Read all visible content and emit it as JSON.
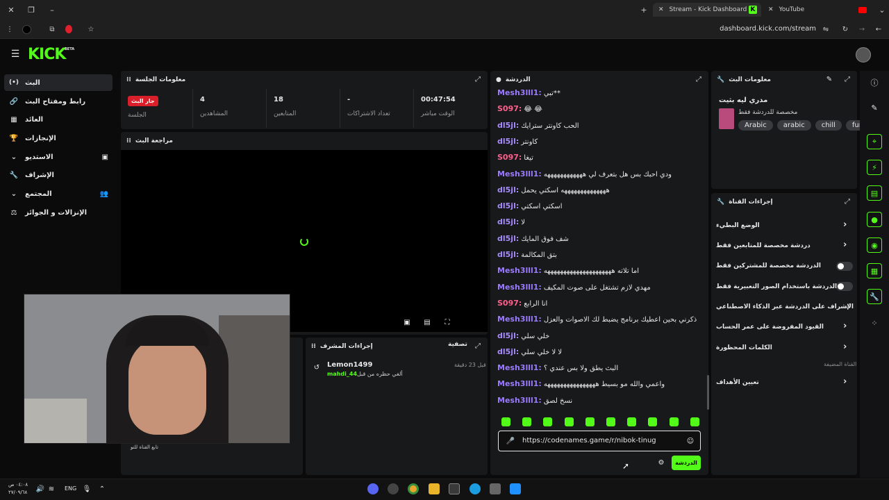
{
  "browser": {
    "tabs": [
      {
        "label": "Stream - Kick Dashboard"
      },
      {
        "label": "YouTube"
      }
    ],
    "url": "dashboard.kick.com/stream"
  },
  "kick": {
    "logo": "KICK",
    "beta": "BETA"
  },
  "sidebar": {
    "items": [
      {
        "label": "البث",
        "icon": "broadcast-icon"
      },
      {
        "label": "رابط ومفتاح البث",
        "icon": "link-icon"
      },
      {
        "label": "العائد",
        "icon": "revenue-icon"
      },
      {
        "label": "الإنجازات",
        "icon": "trophy-icon"
      },
      {
        "label": "الاستديو",
        "icon": "studio-icon"
      },
      {
        "label": "الإشراف",
        "icon": "wrench-icon"
      },
      {
        "label": "المجتمع",
        "icon": "community-icon"
      },
      {
        "label": "الإنزالات و الجوائز",
        "icon": "drops-icon"
      }
    ]
  },
  "session": {
    "title": "معلومات الجلسة",
    "live_badge": "جار البث",
    "live_label": "الجلسة",
    "stats": [
      {
        "value": "4",
        "label": "المشاهدين"
      },
      {
        "value": "18",
        "label": "المتابعين"
      },
      {
        "value": "-",
        "label": "تعداد الاشتراكات"
      },
      {
        "value": "00:47:54",
        "label": "الوقت مباشر"
      }
    ]
  },
  "preview": {
    "title": "مراجعة البث"
  },
  "mod_actions": {
    "title": "إجراءات المشرف",
    "filter": "تصفية",
    "entry_user": "Lemon1499",
    "entry_time": "قبل 23 دقيقة",
    "entry_text": "ألغي حظره من قبل",
    "entry_actor": "mahdi_44",
    "follow_text": "تابع القناة للتو"
  },
  "chat": {
    "title": "الدردشة",
    "messages": [
      {
        "user": "Mesh3lll1:",
        "text": "**تبي",
        "color": "#9b7bff"
      },
      {
        "user": "S097:",
        "text": "😂 😂",
        "color": "#ff5f8d"
      },
      {
        "user": "dl5jl:",
        "text": "الحب كاونتر سترايك",
        "color": "#a78bff"
      },
      {
        "user": "dl5jl:",
        "text": "كاونتر",
        "color": "#a78bff"
      },
      {
        "user": "S097:",
        "text": "تيغا",
        "color": "#ff5f8d"
      },
      {
        "user": "Mesh3lll1:",
        "text": "ودي احبك بس هل بتعرف لي ههههههههههههه",
        "color": "#9b7bff"
      },
      {
        "user": "dl5jl:",
        "text": "ههههههههههههههه اسكتي يحمل",
        "color": "#a78bff"
      },
      {
        "user": "dl5jl:",
        "text": "اسكتي اسكتي",
        "color": "#a78bff"
      },
      {
        "user": "dl5jl:",
        "text": "لا",
        "color": "#a78bff"
      },
      {
        "user": "dl5jl:",
        "text": "شف فوق المايك",
        "color": "#a78bff"
      },
      {
        "user": "dl5jl:",
        "text": "بتق المكالمة",
        "color": "#a78bff"
      },
      {
        "user": "Mesh3lll1:",
        "text": "اما تلاته هههههههههههههههههههههه",
        "color": "#9b7bff"
      },
      {
        "user": "Mesh3lll1:",
        "text": "مهدي لازم تشتغل على صوت المكيف",
        "color": "#9b7bff"
      },
      {
        "user": "S097:",
        "text": "انا الرابع",
        "color": "#ff5f8d"
      },
      {
        "user": "Mesh3lll1:",
        "text": "ذكرني بحين اعطيك برنامج يضبط لك الاصوات والعزل",
        "color": "#9b7bff"
      },
      {
        "user": "dl5jl:",
        "text": "خلي سلي",
        "color": "#a78bff"
      },
      {
        "user": "dl5jl:",
        "text": "لا لا خلي سلي",
        "color": "#a78bff"
      },
      {
        "user": "Mesh3lll1:",
        "text": "البث يطق ولا بس عندي ؟",
        "color": "#9b7bff"
      },
      {
        "user": "Mesh3lll1:",
        "text": "واعمي والله مو بسيط ههههههههههههههههه",
        "color": "#9b7bff"
      },
      {
        "user": "Mesh3lll1:",
        "text": "نسخ لصق",
        "color": "#9b7bff"
      }
    ],
    "input_value": "https://codenames.game/r/nibok-tinug",
    "send_label": "الدردشة"
  },
  "stream_info": {
    "title": "معلومات البث",
    "stream_title": "مدري ليه بثيت",
    "category": "مخصصة للدردشة فقط",
    "tags": [
      "Arabic",
      "arabic",
      "chill",
      "funny"
    ]
  },
  "channel_actions": {
    "title": "إجراءات القناة",
    "rows": [
      {
        "label": "الوضع البطيء",
        "kind": "chevron"
      },
      {
        "label": "دردشة مخصصة للمتابعين فقط",
        "kind": "chevron"
      },
      {
        "label": "الدردشة مخصصة للمشتركين فقط",
        "kind": "toggle"
      },
      {
        "label": "الدردشة باستخدام الصور التعبيرية فقط",
        "kind": "toggle"
      },
      {
        "label": "الإشراف على الدردشة عبر الذكاء الاصطناعي",
        "kind": "external"
      },
      {
        "label": "القيود المفروضة على عمر الحساب",
        "kind": "chevron"
      },
      {
        "label": "الكلمات المحظورة",
        "kind": "chevron"
      }
    ],
    "section_label": "القناة المضيفة",
    "goals_label": "تعيين الأهداف"
  },
  "taskbar": {
    "lang": "ENG",
    "time": "٠٤:٠٨ ص",
    "date": "٢٧/٠٩/٦٨"
  },
  "colors": {
    "accent": "#53fc18",
    "panel": "#18191b",
    "bg": "#0b0b0c"
  }
}
